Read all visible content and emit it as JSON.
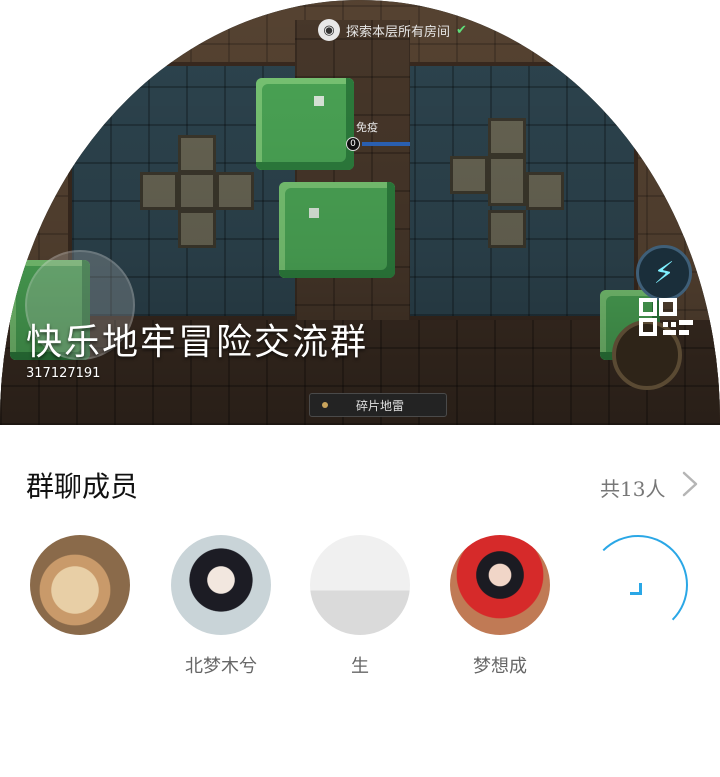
{
  "hero": {
    "top_hint": "探索本层所有房间",
    "immunity_label": "免疫",
    "immunity_counter": "0",
    "weapon_label": "碎片地雷",
    "group_name": "快乐地牢冒险交流群",
    "group_id": "317127191"
  },
  "members": {
    "title": "群聊成员",
    "count_label": "共13人",
    "items": [
      {
        "name": ""
      },
      {
        "name": "北梦木兮"
      },
      {
        "name": "生"
      },
      {
        "name": "梦想成"
      },
      {
        "name": ""
      }
    ]
  },
  "colors": {
    "accent": "#2aa7e6",
    "check": "#5ee07a"
  }
}
